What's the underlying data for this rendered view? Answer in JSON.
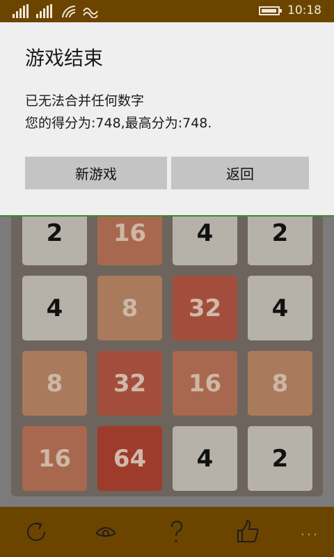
{
  "status_bar": {
    "time": "10:18",
    "icons": [
      "signal-icon",
      "signal-icon",
      "wifi-icon",
      "data-sense-icon",
      "battery-icon"
    ]
  },
  "dialog": {
    "title": "游戏结束",
    "line1": "已无法合并任何数字",
    "line2": "您的得分为:748,最高分为:748.",
    "new_game_label": "新游戏",
    "back_label": "返回"
  },
  "board": {
    "rows": [
      [
        "2",
        "16",
        "4",
        "2"
      ],
      [
        "4",
        "8",
        "32",
        "4"
      ],
      [
        "8",
        "32",
        "16",
        "8"
      ],
      [
        "16",
        "64",
        "4",
        "2"
      ]
    ]
  },
  "app_bar": {
    "buttons": [
      "refresh-icon",
      "eye-icon",
      "help-icon",
      "thumbs-up-icon"
    ],
    "more": "..."
  }
}
